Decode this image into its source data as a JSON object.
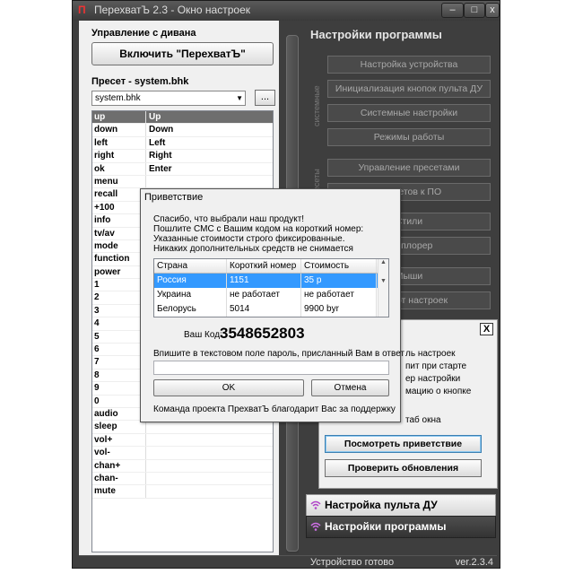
{
  "window": {
    "title": "ПерехватЪ 2.3 - Окно настроек",
    "app_icon": "П",
    "controls": {
      "minimize": "–",
      "maximize": "□",
      "close": "x"
    }
  },
  "left": {
    "couch_header": "Управление с дивана",
    "enable_button": "Включить \"ПерехватЪ\"",
    "preset_header": "Пресет - system.bhk",
    "preset_value": "system.bhk",
    "preset_arrow": "▼",
    "browse_button": "...",
    "keys": [
      {
        "k": "up",
        "v": "Up"
      },
      {
        "k": "down",
        "v": "Down"
      },
      {
        "k": "left",
        "v": "Left"
      },
      {
        "k": "right",
        "v": "Right"
      },
      {
        "k": "ok",
        "v": "Enter"
      },
      {
        "k": "menu",
        "v": ""
      },
      {
        "k": "recall",
        "v": ""
      },
      {
        "k": "+100",
        "v": ""
      },
      {
        "k": "info",
        "v": ""
      },
      {
        "k": "tv/av",
        "v": ""
      },
      {
        "k": "mode",
        "v": ""
      },
      {
        "k": "function",
        "v": ""
      },
      {
        "k": "power",
        "v": ""
      },
      {
        "k": "1",
        "v": ""
      },
      {
        "k": "2",
        "v": ""
      },
      {
        "k": "3",
        "v": ""
      },
      {
        "k": "4",
        "v": ""
      },
      {
        "k": "5",
        "v": ""
      },
      {
        "k": "6",
        "v": ""
      },
      {
        "k": "7",
        "v": ""
      },
      {
        "k": "8",
        "v": ""
      },
      {
        "k": "9",
        "v": ""
      },
      {
        "k": "0",
        "v": ""
      },
      {
        "k": "audio",
        "v": ""
      },
      {
        "k": "sleep",
        "v": ""
      },
      {
        "k": "vol+",
        "v": ""
      },
      {
        "k": "vol-",
        "v": ""
      },
      {
        "k": "chan+",
        "v": ""
      },
      {
        "k": "chan-",
        "v": ""
      },
      {
        "k": "mute",
        "v": ""
      }
    ]
  },
  "right": {
    "title": "Настройки программы",
    "label_system": "системные",
    "label_presets": "пресеты",
    "buttons": [
      "Настройка устройства",
      "Инициализация кнопок пульта ДУ",
      "Системные настройки",
      "Режимы работы",
      "Управление пресетами",
      "Пресетов к ПО",
      "Стили",
      "Эксплорер",
      "Мыши",
      "Экспорт настроек"
    ],
    "subpanel": {
      "close": "X",
      "items": [
        "ль настроек",
        "пит при старте",
        "ер настройки",
        "мацию о кнопке",
        "таб окна"
      ],
      "view_greeting": "Посмотреть приветствие",
      "check_updates": "Проверить обновления"
    },
    "tab_remote": "Настройка пульта ДУ",
    "tab_program": "Настройки программы"
  },
  "status": {
    "text": "Устройство готово",
    "version": "ver.2.3.4"
  },
  "dialog": {
    "title": "Приветствие",
    "lines": [
      "Спасибо, что выбрали наш продукт!",
      "Пошлите СМС с Вашим кодом на короткий номер:",
      "Указанные стоимости строго фиксированные.",
      "Никаких дополнительных средств не снимается"
    ],
    "columns": [
      "Страна",
      "Короткий номер",
      "Стоимость"
    ],
    "rows": [
      [
        "Россия",
        "1151",
        "35 р"
      ],
      [
        "Украина",
        "не работает",
        "не работает"
      ],
      [
        "Белорусь",
        "5014",
        "9900 byr"
      ]
    ],
    "code_label": "Ваш Код:",
    "code_value": "3548652803",
    "password_hint": "Впишите в текстовом поле пароль, присланный Вам в ответ",
    "password_value": "",
    "ok": "OK",
    "cancel": "Отмена",
    "footer": "Команда проекта ПрехватЪ благодарит Вас за поддержку"
  }
}
